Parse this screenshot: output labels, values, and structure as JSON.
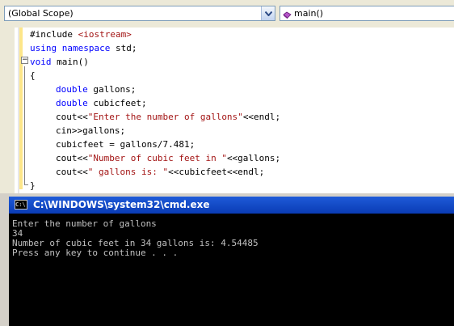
{
  "navbar": {
    "scope_value": "(Global Scope)",
    "member_value": "main()"
  },
  "code": {
    "lines": [
      [
        "#include ",
        "<iostream>"
      ],
      [
        "using",
        " ",
        "namespace",
        " std;"
      ],
      [
        "void",
        " main()"
      ],
      [
        "{"
      ],
      [
        "double",
        " gallons;"
      ],
      [
        "double",
        " cubicfeet;"
      ],
      [
        "cout<<",
        "\"Enter the number of gallons\"",
        "<<endl;"
      ],
      [
        "cin>>gallons;"
      ],
      [
        "cubicfeet = gallons/7.481;"
      ],
      [
        "cout<<",
        "\"Number of cubic feet in \"",
        "<<gallons;"
      ],
      [
        "cout<<",
        "\" gallons is: \"",
        "<<cubicfeet<<endl;"
      ],
      [
        "}"
      ]
    ]
  },
  "cmd": {
    "title": "C:\\WINDOWS\\system32\\cmd.exe",
    "icon_label": "C:\\",
    "output": [
      "Enter the number of gallons",
      "34",
      "Number of cubic feet in 34 gallons is: 4.54485",
      "Press any key to continue . . ."
    ]
  },
  "colors": {
    "keyword": "#0000ff",
    "string": "#a31515",
    "title_bar": "#0a3bb5",
    "console_text": "#c0c0c0"
  },
  "icons": {
    "scope_dropdown": "chevron-down-icon",
    "member": "method-icon",
    "collapse": "collapse-minus-icon",
    "console": "console-icon"
  }
}
